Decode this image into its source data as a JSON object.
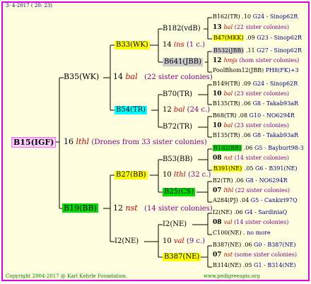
{
  "header": {
    "date": "3- 4-2017 ( 20: 23)"
  },
  "footer": {
    "copyright": "Copyright 2004-2017 @ Karl Kehrle Foundation.",
    "site": "www.pedigreeapis.org"
  },
  "root": {
    "name": "B15(IGF)",
    "num": "16",
    "loc": "lthl",
    "note": "(Drones from 33 sister colonies)"
  },
  "gen1": {
    "top": {
      "name": "B35(WK)",
      "num": "14",
      "loc": "bal",
      "note": "(22 sister colonies)"
    },
    "bot": {
      "name": "B19(BB)",
      "num": "12",
      "loc": "nst",
      "note": "(14 sister colonies)"
    }
  },
  "gen2": {
    "a": {
      "name": "B33(WK)",
      "num": "14",
      "loc": "ins",
      "note": "(1 c.)"
    },
    "b": {
      "name": "B54(TR)",
      "num": "12",
      "loc": "bal",
      "note": "(24 c.)"
    },
    "c": {
      "name": "B27(BB)",
      "num": "10",
      "loc": "lthl",
      "note": "(32 c.)"
    },
    "d": {
      "name": "I2(NE)",
      "num": "10",
      "loc": "val",
      "note": "(9 c.)"
    }
  },
  "gen3": {
    "a1": "B182(vdB)",
    "a2": "B641(JBB)",
    "b1": "B70(TR)",
    "b2": "B72(TR)",
    "c1": "B53(BB)",
    "c2": "B25(CS)",
    "d1": "I2(NE)",
    "d2": "B387(NE)"
  },
  "gen4": [
    {
      "name": "B162(TR)",
      "yr": ".10",
      "link": "G24 - Sinop62R",
      "row": "sire"
    },
    {
      "num": "13",
      "loc": "bal",
      "note": "(22 sister colonies)",
      "row": "drone"
    },
    {
      "name": "B47(MKK)",
      "yr": ".09",
      "link": "G23 - Sinop62R",
      "row": "dam"
    },
    {
      "name": "B532(JBB)",
      "yr": ".11",
      "link": "G27 - Sinop62R",
      "row": "sire"
    },
    {
      "num": "12",
      "loc": "hmjs",
      "note": "(hom sister colonies)",
      "row": "drone"
    },
    {
      "name": "PoolBhom12(JBB)",
      "yr": "",
      "link": "PH8(FK)+3",
      "row": "dam"
    },
    {
      "name": "B149(TR)",
      "yr": ".09",
      "link": "G24 - Sinop62R",
      "row": "sire"
    },
    {
      "num": "10",
      "loc": "bal",
      "note": "(23 sister colonies)",
      "row": "drone"
    },
    {
      "name": "B135(TR)",
      "yr": ".06",
      "link": "G8 - Takab93aR",
      "row": "dam"
    },
    {
      "name": "B68(TR)",
      "yr": ".08",
      "link": "G10 - NO6294R",
      "row": "sire"
    },
    {
      "num": "10",
      "loc": "bal",
      "note": "(23 sister colonies)",
      "row": "drone"
    },
    {
      "name": "B135(TR)",
      "yr": ".06",
      "link": "G8 - Takab93aR",
      "row": "dam"
    },
    {
      "name": "B102(BB)",
      "yr": ".06",
      "link": "G5 - Bayburt98-3",
      "row": "sire"
    },
    {
      "num": "08",
      "loc": "nst",
      "note": "(14 sister colonies)",
      "row": "drone"
    },
    {
      "name": "B391(NE)",
      "yr": ".05",
      "link": "G6 - B391(NE)",
      "row": "dam"
    },
    {
      "name": "B2(TR)",
      "yr": ".06",
      "link": "G8 - NO6294R",
      "row": "sire"
    },
    {
      "num": "07",
      "loc": "lthl",
      "note": "(22 sister colonies)",
      "row": "drone"
    },
    {
      "name": "A284(PJ)",
      "yr": ".04",
      "link": "G5 - Cankiri97Q",
      "row": "dam"
    },
    {
      "name": "I2(NE)",
      "yr": ".06",
      "link": "G4 - SardiniaQ",
      "row": "sire"
    },
    {
      "num": "08",
      "loc": "val",
      "note": "(14 sister colonies)",
      "row": "drone"
    },
    {
      "name": "C100(NE)",
      "yr": ".",
      "link": "no more",
      "row": "dam"
    },
    {
      "name": "B387(NE)",
      "yr": ".06",
      "link": "G0 - B387(NE)",
      "row": "sire"
    },
    {
      "num": "07",
      "loc": "nst",
      "note": "(some sister colonies)",
      "row": "drone"
    },
    {
      "name": "B314(NE)",
      "yr": ".05",
      "link": "G1 - B314(NE)",
      "row": "dam"
    }
  ]
}
